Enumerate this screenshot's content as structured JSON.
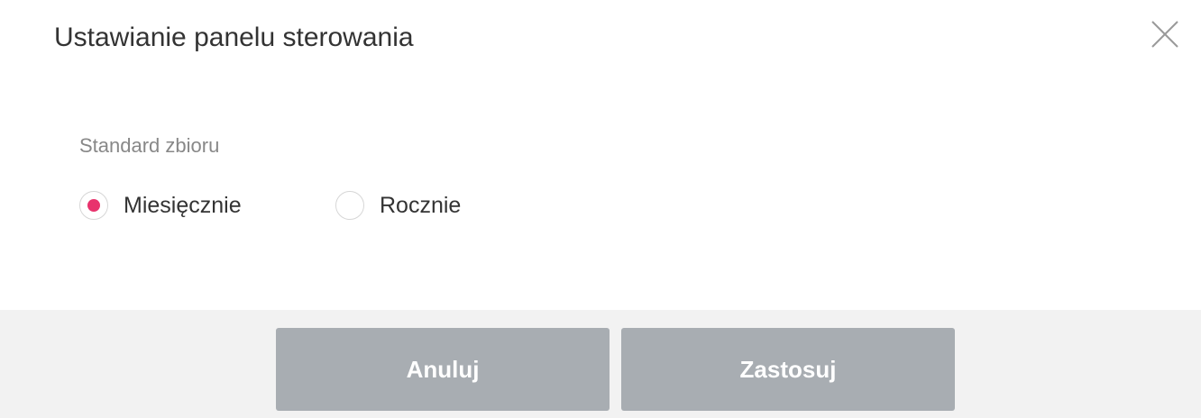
{
  "dialog": {
    "title": "Ustawianie panelu sterowania",
    "close_icon": "close-icon"
  },
  "collection_standard": {
    "label": "Standard zbioru",
    "options": [
      {
        "label": "Miesięcznie",
        "selected": true
      },
      {
        "label": "Rocznie",
        "selected": false
      }
    ]
  },
  "footer": {
    "cancel_label": "Anuluj",
    "apply_label": "Zastosuj"
  },
  "colors": {
    "accent": "#e8336d",
    "button_bg": "#a8adb2",
    "footer_bg": "#f2f2f2"
  }
}
